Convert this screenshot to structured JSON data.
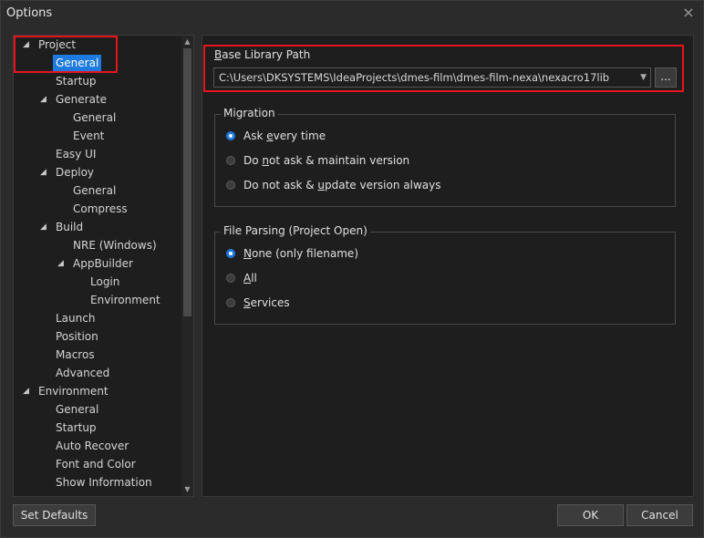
{
  "window": {
    "title": "Options",
    "close_glyph": "×"
  },
  "tree": {
    "items": [
      {
        "label": "Project",
        "expanded": true
      },
      {
        "label": "General",
        "selected": true
      },
      {
        "label": "Startup"
      },
      {
        "label": "Generate",
        "expanded": true
      },
      {
        "label": "General"
      },
      {
        "label": "Event"
      },
      {
        "label": "Easy UI"
      },
      {
        "label": "Deploy",
        "expanded": true
      },
      {
        "label": "General"
      },
      {
        "label": "Compress"
      },
      {
        "label": "Build",
        "expanded": true
      },
      {
        "label": "NRE (Windows)"
      },
      {
        "label": "AppBuilder",
        "expanded": true
      },
      {
        "label": "Login"
      },
      {
        "label": "Environment"
      },
      {
        "label": "Launch"
      },
      {
        "label": "Position"
      },
      {
        "label": "Macros"
      },
      {
        "label": "Advanced"
      },
      {
        "label": "Environment",
        "expanded": true
      },
      {
        "label": "General"
      },
      {
        "label": "Startup"
      },
      {
        "label": "Auto Recover"
      },
      {
        "label": "Font and Color"
      },
      {
        "label": "Show Information"
      }
    ],
    "expand_glyph": "◢",
    "scroll_up_glyph": "▲",
    "scroll_down_glyph": "▼"
  },
  "base_library": {
    "label_mnemonic": "B",
    "label_rest": "ase Library Path",
    "value": "C:\\Users\\DKSYSTEMS\\IdeaProjects\\dmes-film\\dmes-film-nexa\\nexacro17lib",
    "dropdown_glyph": "▼",
    "browse_label": "..."
  },
  "migration": {
    "legend": "Migration",
    "options": [
      {
        "before": "Ask ",
        "mnemonic": "e",
        "after": "very time",
        "checked": true
      },
      {
        "before": "Do ",
        "mnemonic": "n",
        "after": "ot ask & maintain version",
        "checked": false
      },
      {
        "before": "Do not ask & ",
        "mnemonic": "u",
        "after": "pdate version always",
        "checked": false
      }
    ]
  },
  "file_parsing": {
    "legend": "File Parsing (Project Open)",
    "options": [
      {
        "before": "",
        "mnemonic": "N",
        "after": "one (only filename)",
        "checked": true
      },
      {
        "before": "",
        "mnemonic": "A",
        "after": "ll",
        "checked": false
      },
      {
        "before": "",
        "mnemonic": "S",
        "after": "ervices",
        "checked": false
      }
    ]
  },
  "footer": {
    "set_defaults": "Set Defaults",
    "ok": "OK",
    "cancel": "Cancel"
  },
  "colors": {
    "accent": "#1c7ae0",
    "highlight_box": "#e8141c",
    "background": "#2b2b2b",
    "panel": "#1e1e1e"
  }
}
